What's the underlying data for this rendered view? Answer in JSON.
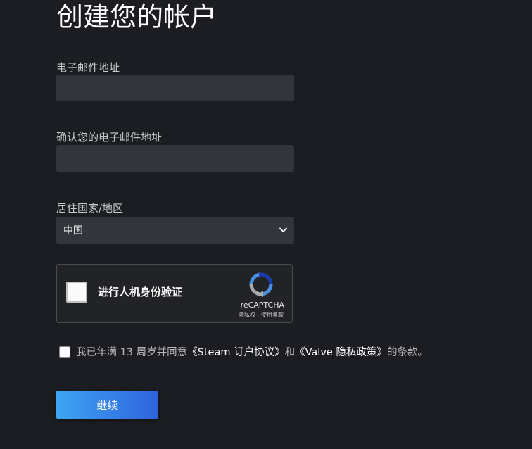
{
  "form": {
    "title": "创建您的帐户",
    "email_label": "电子邮件地址",
    "email_value": "",
    "confirm_email_label": "确认您的电子邮件地址",
    "confirm_email_value": "",
    "country_label": "居住国家/地区",
    "country_value": "中国"
  },
  "captcha": {
    "label": "进行人机身份验证",
    "brand": "reCAPTCHA",
    "privacy_link": "隐私权",
    "separator": " - ",
    "terms_link": "使用条款",
    "logo_icon": "recaptcha-logo-icon"
  },
  "agreement": {
    "prefix": "我已年满 13 周岁并同意",
    "steam_link": "《Steam 订户协议》",
    "middle": "和",
    "valve_link": "《Valve 隐私政策》",
    "suffix": "的条款。"
  },
  "actions": {
    "continue_label": "继续"
  },
  "colors": {
    "background": "#1b1d22",
    "input_bg": "#32353c",
    "button_start": "#3ea5f4",
    "button_end": "#2e63dc"
  }
}
